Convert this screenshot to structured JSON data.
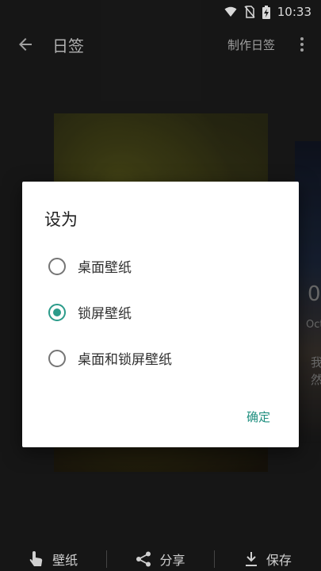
{
  "status": {
    "time": "10:33"
  },
  "appbar": {
    "title": "日签",
    "make_label": "制作日签"
  },
  "background_side": {
    "text1": "0",
    "text2": "Oct",
    "text3": "我",
    "text4": "然"
  },
  "dialog": {
    "title": "设为",
    "options": [
      {
        "label": "桌面壁纸",
        "selected": false
      },
      {
        "label": "锁屏壁纸",
        "selected": true
      },
      {
        "label": "桌面和锁屏壁纸",
        "selected": false
      }
    ],
    "confirm_label": "确定",
    "accent": "#2b9b8a"
  },
  "bottom": {
    "wallpaper_label": "壁纸",
    "share_label": "分享",
    "save_label": "保存"
  }
}
